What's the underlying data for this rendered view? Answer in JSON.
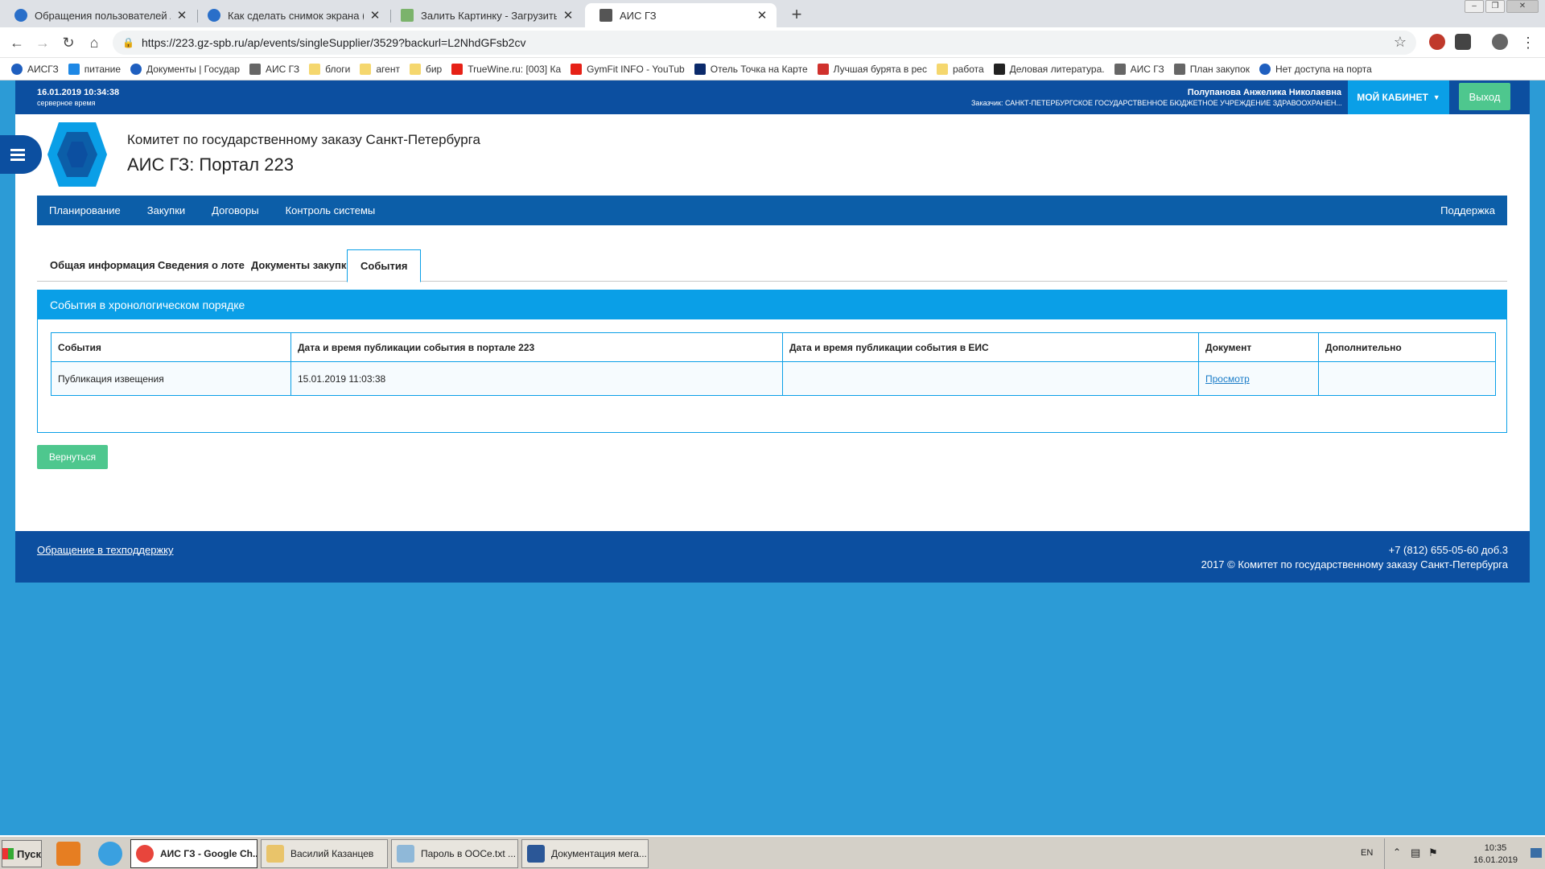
{
  "browser": {
    "tabs": [
      {
        "title": "Обращения пользователей АИСГЗ",
        "active": false
      },
      {
        "title": "Как сделать снимок экрана (скри",
        "active": false
      },
      {
        "title": "Залить Картинку - Загрузить фото",
        "active": false
      },
      {
        "title": "АИС ГЗ",
        "active": true
      }
    ],
    "url": "https://223.gz-spb.ru/ap/events/singleSupplier/3529?backurl=L2NhdGFsb2cv",
    "bookmarks": [
      "АИСГЗ",
      "питание",
      "Документы | Государ",
      "АИС ГЗ",
      "блоги",
      "агент",
      "бир",
      "TrueWine.ru: [003] Ка",
      "GymFit INFO - YouTub",
      "Отель Точка на Карте",
      "Лучшая бурята в рес",
      "работа",
      "Деловая литература.",
      "АИС ГЗ",
      "План закупок",
      "Нет доступа на порта"
    ]
  },
  "topbar": {
    "datetime": "16.01.2019 10:34:38",
    "server_label": "серверное время",
    "user_name": "Полупанова Анжелика Николаевна",
    "org": "Заказчик: САНКТ-ПЕТЕРБУРГСКОЕ ГОСУДАРСТВЕННОЕ БЮДЖЕТНОЕ УЧРЕЖДЕНИЕ ЗДРАВООХРАНЕН...",
    "cabinet_label": "МОЙ КАБИНЕТ",
    "logout_label": "Выход"
  },
  "header": {
    "line1": "Комитет по государственному заказу Санкт-Петербурга",
    "line2": "АИС ГЗ: Портал 223"
  },
  "mainnav": {
    "items": [
      "Планирование",
      "Закупки",
      "Договоры",
      "Контроль системы"
    ],
    "support": "Поддержка"
  },
  "tabs": [
    "Общая информация",
    "Сведения о лоте",
    "Документы закупки",
    "События"
  ],
  "panel": {
    "title": "События в хронологическом порядке",
    "columns": [
      "События",
      "Дата и время публикации события в портале 223",
      "Дата и время публикации события в ЕИС",
      "Документ",
      "Дополнительно"
    ],
    "rows": [
      {
        "event": "Публикация извещения",
        "portal_date": "15.01.2019 11:03:38",
        "eis_date": "",
        "document": "Просмотр",
        "extra": ""
      }
    ]
  },
  "back_label": "Вернуться",
  "footer": {
    "support_link": "Обращение в техподдержку",
    "phone": "+7 (812) 655-05-60 доб.3",
    "copyright": "2017 © Комитет по государственному заказу Санкт-Петербурга"
  },
  "taskbar": {
    "start": "Пуск",
    "items": [
      "АИС ГЗ - Google Ch...",
      "Василий Казанцев",
      "Пароль в ООСе.txt ...",
      "Документация мега..."
    ],
    "lang": "EN",
    "time": "10:35",
    "date": "16.01.2019"
  },
  "colors": {
    "brand_dark": "#0c4fa0",
    "accent": "#0a9fe7",
    "success": "#4ec78e",
    "desktop": "#2c9bd6"
  }
}
